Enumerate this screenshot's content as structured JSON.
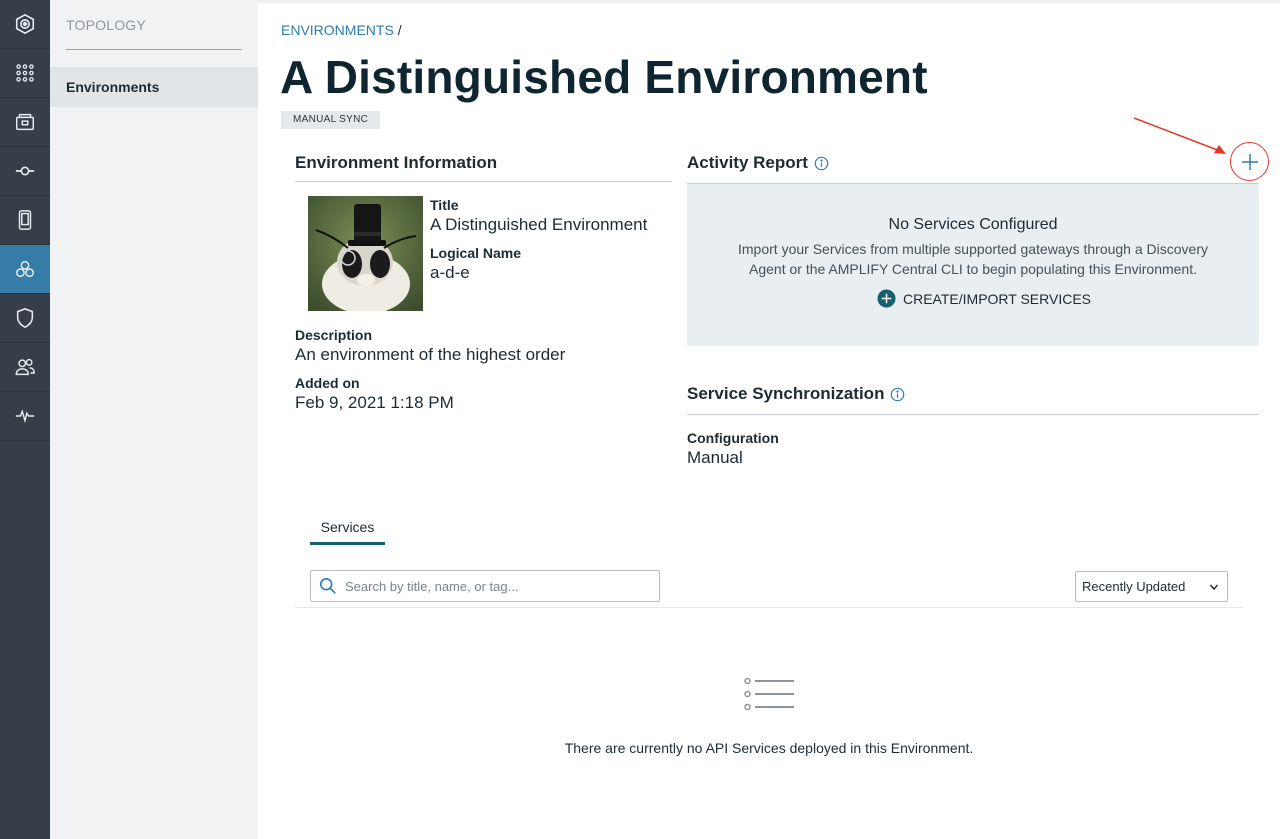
{
  "rail": {
    "items": [
      {
        "icon": "product-logo-icon",
        "active": false
      },
      {
        "icon": "apps-grid-icon",
        "active": false
      },
      {
        "icon": "catalog-icon",
        "active": false
      },
      {
        "icon": "topology-node-icon",
        "active": false
      },
      {
        "icon": "mobile-device-icon",
        "active": false
      },
      {
        "icon": "environments-cluster-icon",
        "active": true
      },
      {
        "icon": "shield-icon",
        "active": false
      },
      {
        "icon": "users-icon",
        "active": false
      },
      {
        "icon": "activity-pulse-icon",
        "active": false
      }
    ]
  },
  "subnav": {
    "heading": "TOPOLOGY",
    "items": [
      {
        "label": "Environments",
        "active": true
      }
    ]
  },
  "breadcrumb": {
    "link": "ENVIRONMENTS",
    "separator": "/"
  },
  "page": {
    "title": "A Distinguished Environment",
    "badge": "MANUAL SYNC"
  },
  "environment_info": {
    "heading": "Environment Information",
    "title_label": "Title",
    "title_value": "A Distinguished Environment",
    "logical_label": "Logical Name",
    "logical_value": "a-d-e",
    "description_label": "Description",
    "description_value": "An environment of the highest order",
    "added_label": "Added on",
    "added_value": "Feb 9, 2021 1:18 PM"
  },
  "activity": {
    "heading": "Activity Report",
    "empty_title": "No Services Configured",
    "empty_text": "Import your Services from multiple supported gateways through a Discovery Agent or the AMPLIFY Central CLI to begin populating this Environment.",
    "create_label": "CREATE/IMPORT SERVICES"
  },
  "sync": {
    "heading": "Service Synchronization",
    "config_label": "Configuration",
    "config_value": "Manual"
  },
  "services": {
    "tab": "Services",
    "search_placeholder": "Search by title, name, or tag...",
    "sort_value": "Recently Updated",
    "empty_message": "There are currently no API Services deployed in this Environment."
  },
  "colors": {
    "rail_bg": "#353e49",
    "rail_active": "#357da7",
    "accent_link": "#2e7bb0",
    "create_icon": "#16606f",
    "annotation": "#e53824"
  }
}
